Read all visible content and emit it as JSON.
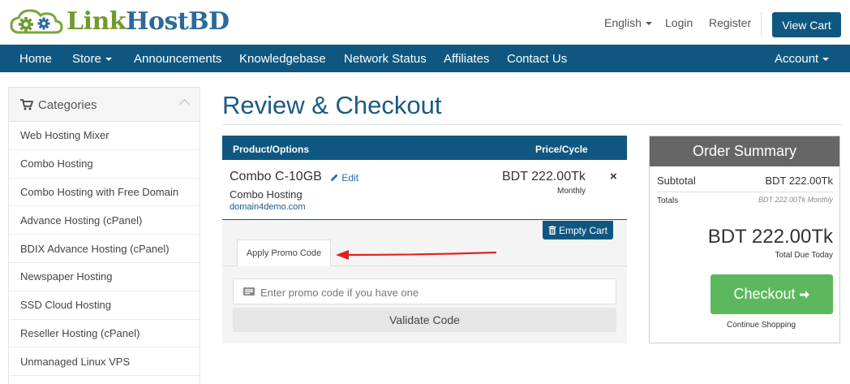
{
  "brand": {
    "part1": "Link",
    "part2": "HostBD",
    "green": "#6f9a2e",
    "blue": "#2b6a9a"
  },
  "header": {
    "language": "English",
    "login": "Login",
    "register": "Register",
    "view_cart": "View Cart"
  },
  "nav": {
    "items": [
      "Home",
      "Store",
      "Announcements",
      "Knowledgebase",
      "Network Status",
      "Affiliates",
      "Contact Us"
    ],
    "account": "Account"
  },
  "sidebar": {
    "title": "Categories",
    "icon": "cart-icon",
    "items": [
      "Web Hosting Mixer",
      "Combo Hosting",
      "Combo Hosting with Free Domain",
      "Advance Hosting (cPanel)",
      "BDIX Advance Hosting (cPanel)",
      "Newspaper Hosting",
      "SSD Cloud Hosting",
      "Reseller Hosting (cPanel)",
      "Unmanaged Linux VPS"
    ]
  },
  "main": {
    "title": "Review & Checkout",
    "cart": {
      "col_product": "Product/Options",
      "col_price": "Price/Cycle",
      "product_name": "Combo C-10GB",
      "edit_label": "Edit",
      "product_group": "Combo Hosting",
      "domain": "domain4demo.com",
      "price": "BDT 222.00Tk",
      "cycle": "Monthly",
      "remove_symbol": "×",
      "empty_cart": "Empty Cart"
    },
    "promo": {
      "tab_label": "Apply Promo Code",
      "placeholder": "Enter promo code if you have one",
      "validate_label": "Validate Code"
    }
  },
  "summary": {
    "title": "Order Summary",
    "subtotal_label": "Subtotal",
    "subtotal_value": "BDT 222.00Tk",
    "totals_label": "Totals",
    "totals_value": "BDT 222.00Tk Monthly",
    "total_due": "BDT 222.00Tk",
    "total_due_label": "Total Due Today",
    "checkout_label": "Checkout",
    "continue_label": "Continue Shopping"
  },
  "colors": {
    "primary": "#0f5780",
    "checkout": "#5cb85c",
    "summary_header": "#666666",
    "annotation_arrow": "#e02020"
  }
}
